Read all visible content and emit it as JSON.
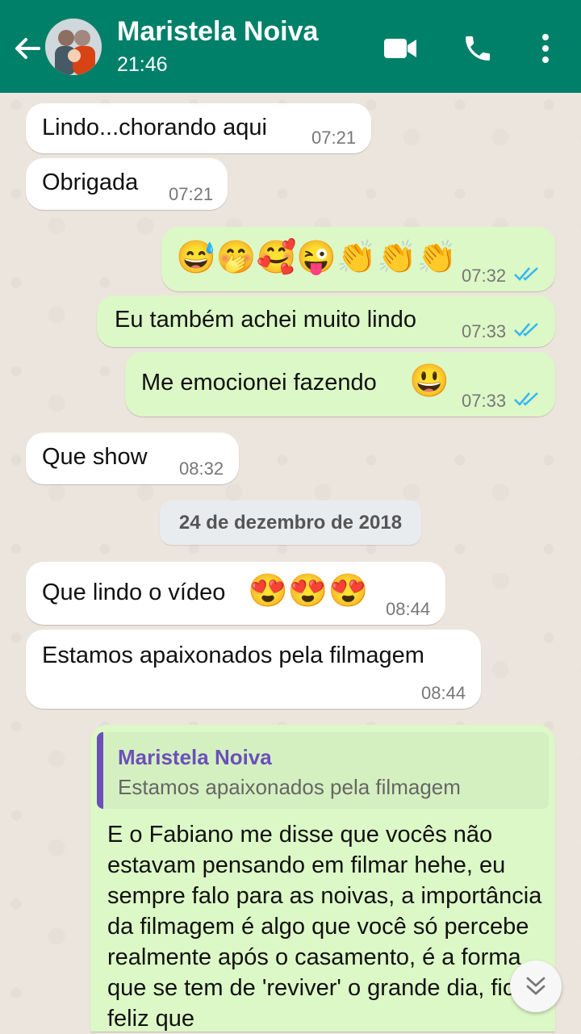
{
  "header": {
    "contact_name": "Maristela Noiva",
    "last_seen": "21:46",
    "icons": [
      "back-arrow-icon",
      "video-call-icon",
      "phone-icon",
      "more-vert-icon"
    ],
    "color": "#008069"
  },
  "messages": [
    {
      "direction": "in",
      "text": "Lindo...chorando aqui",
      "time": "07:21"
    },
    {
      "direction": "in",
      "text": "Obrigada",
      "time": "07:21"
    },
    {
      "direction": "out",
      "emojis": "😅🤭🥰😜👏👏👏",
      "time": "07:32",
      "status": "read"
    },
    {
      "direction": "out",
      "text": "Eu também achei muito lindo",
      "time": "07:33",
      "status": "read"
    },
    {
      "direction": "out",
      "text": "Me emocionei fazendo",
      "emoji": "😃",
      "time": "07:33",
      "status": "read"
    },
    {
      "direction": "in",
      "text": "Que show",
      "time": "08:32"
    },
    {
      "direction": "in",
      "text": "Que lindo o vídeo",
      "emoji": "😍😍😍",
      "time": "08:44"
    },
    {
      "direction": "in",
      "text": "Estamos apaixonados pela filmagem",
      "time": "08:44"
    }
  ],
  "date_divider": "24 de dezembro de 2018",
  "reply": {
    "quote_name": "Maristela Noiva",
    "quote_text": "Estamos apaixonados pela filmagem",
    "text": "E o Fabiano me disse que vocês não estavam pensando em filmar hehe, eu sempre falo para as noivas, a importância da filmagem é algo que você só percebe realmente após o casamento, é a forma que se tem de 'reviver' o grande dia, fico feliz que"
  },
  "colors": {
    "incoming": "#ffffff",
    "outgoing": "#dcf8c6",
    "read_ticks": "#34b7f1",
    "quote_accent": "#6b4fbb"
  }
}
